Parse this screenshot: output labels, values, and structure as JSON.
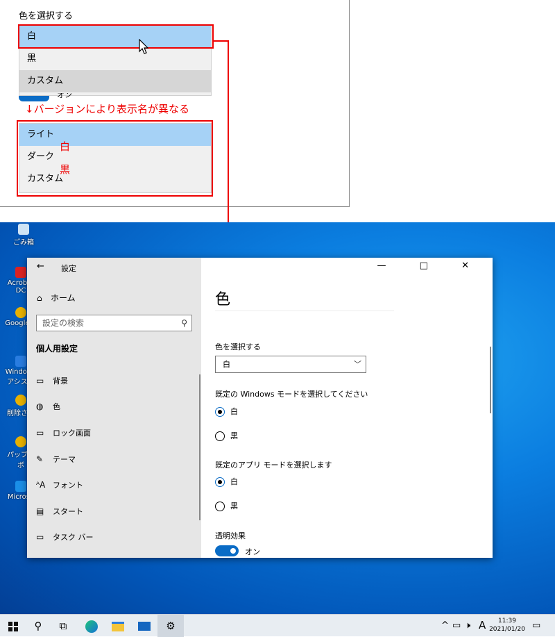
{
  "callout": {
    "caption": "色を選択する",
    "list1": [
      "白",
      "黒",
      "カスタム"
    ],
    "toggle_peek": "オン",
    "note": "↓バージョンにより表示名が異なる",
    "list2": [
      "ライト",
      "ダーク",
      "カスタム"
    ],
    "map_white": "白",
    "map_black": "黒"
  },
  "desktop": {
    "icons": [
      "ごみ箱",
      "Acrobat\nDC",
      "Google C",
      "Windows\nアシスタ",
      "削除され",
      "パッブル\nボ",
      "Microso"
    ]
  },
  "window": {
    "title": "設定",
    "back_glyph": "←",
    "controls": "— □ ✕",
    "nav": {
      "home": "ホーム",
      "search_placeholder": "設定の検索",
      "section": "個人用設定",
      "items": [
        {
          "icon": "picture-icon",
          "label": "背景"
        },
        {
          "icon": "palette-icon",
          "label": "色"
        },
        {
          "icon": "lock-screen-icon",
          "label": "ロック画面"
        },
        {
          "icon": "theme-icon",
          "label": "テーマ"
        },
        {
          "icon": "font-icon",
          "label": "フォント"
        },
        {
          "icon": "start-icon",
          "label": "スタート"
        },
        {
          "icon": "taskbar-icon",
          "label": "タスク バー"
        }
      ]
    },
    "content": {
      "title": "色",
      "choose_color_label": "色を選択する",
      "choose_color_value": "白",
      "windows_mode_label": "既定の Windows モードを選択してください",
      "windows_mode_options": [
        "白",
        "黒"
      ],
      "windows_mode_selected": "白",
      "app_mode_label": "既定のアプリ モードを選択します",
      "app_mode_options": [
        "白",
        "黒"
      ],
      "app_mode_selected": "白",
      "transparency_label": "透明効果",
      "transparency_state": "オン"
    }
  },
  "taskbar": {
    "ime": "A",
    "time": "11:39",
    "date": "2021/01/20",
    "accent": "#0a6cc6"
  }
}
